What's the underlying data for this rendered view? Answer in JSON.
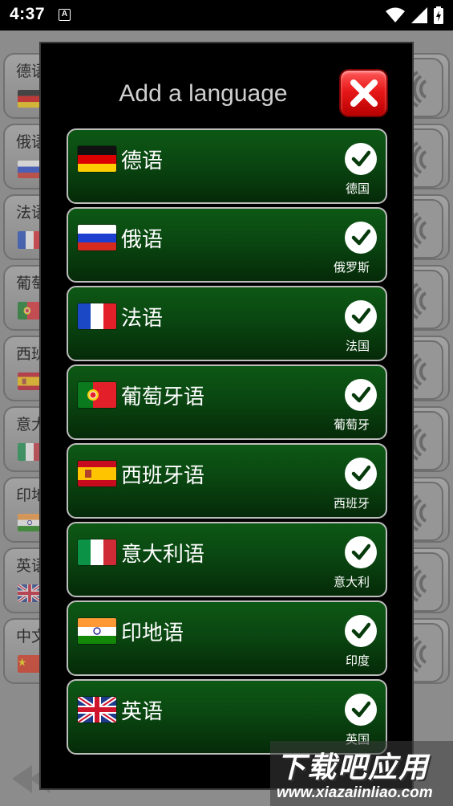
{
  "status_bar": {
    "time": "4:37",
    "notification_icon": "A"
  },
  "background": {
    "rows": [
      {
        "label": "德语",
        "flag": "de"
      },
      {
        "label": "俄语",
        "flag": "ru"
      },
      {
        "label": "法语",
        "flag": "fr"
      },
      {
        "label": "葡萄",
        "flag": "pt"
      },
      {
        "label": "西班",
        "flag": "es"
      },
      {
        "label": "意大",
        "flag": "it"
      },
      {
        "label": "印地",
        "flag": "in"
      },
      {
        "label": "英语",
        "flag": "gb"
      },
      {
        "label": "中文",
        "flag": "cn"
      }
    ]
  },
  "dialog": {
    "title": "Add a language",
    "close_icon": "close-x-icon",
    "languages": [
      {
        "name": "德语",
        "country": "德国",
        "flag": "de",
        "selected": true
      },
      {
        "name": "俄语",
        "country": "俄罗斯",
        "flag": "ru",
        "selected": true
      },
      {
        "name": "法语",
        "country": "法国",
        "flag": "fr",
        "selected": true
      },
      {
        "name": "葡萄牙语",
        "country": "葡萄牙",
        "flag": "pt",
        "selected": true
      },
      {
        "name": "西班牙语",
        "country": "西班牙",
        "flag": "es",
        "selected": true
      },
      {
        "name": "意大利语",
        "country": "意大利",
        "flag": "it",
        "selected": true
      },
      {
        "name": "印地语",
        "country": "印度",
        "flag": "in",
        "selected": true
      },
      {
        "name": "英语",
        "country": "英国",
        "flag": "gb",
        "selected": true
      }
    ]
  },
  "watermark": {
    "title": "下载吧应用",
    "url": "www.xiazaiinliao.com"
  },
  "colors": {
    "item_green_top": "#0d5814",
    "item_green_bottom": "#052a08",
    "close_red": "#e81818",
    "check_fill": "#ffffff"
  }
}
